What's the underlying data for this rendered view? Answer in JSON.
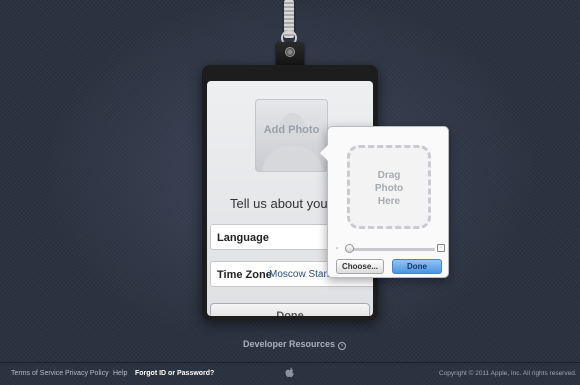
{
  "badge": {
    "photo_label": "Add Photo",
    "prompt": "Tell us about your",
    "fields": [
      {
        "label": "Language",
        "value": ""
      },
      {
        "label": "Time Zone",
        "value": "Moscow Stand"
      }
    ],
    "done_label": "Done"
  },
  "popover": {
    "drop_lines": [
      "Drag",
      "Photo",
      "Here"
    ],
    "choose_label": "Choose...",
    "done_label": "Done",
    "slider_value": 0
  },
  "developer_resources": "Developer Resources",
  "footer": {
    "links": [
      "Terms of Service",
      "Privacy Policy",
      "Help",
      "Forgot ID or Password?"
    ],
    "copyright": "Copyright © 2011 Apple, Inc. All rights reserved."
  },
  "icons": {
    "lanyard": "lanyard-icon",
    "avatar": "person-silhouette-icon",
    "apple": "apple-logo-icon",
    "arrow": "arrow-circle-icon"
  },
  "colors": {
    "background": "#2b3240",
    "accent_button": "#4c95df",
    "link_value": "#2f4e77"
  }
}
